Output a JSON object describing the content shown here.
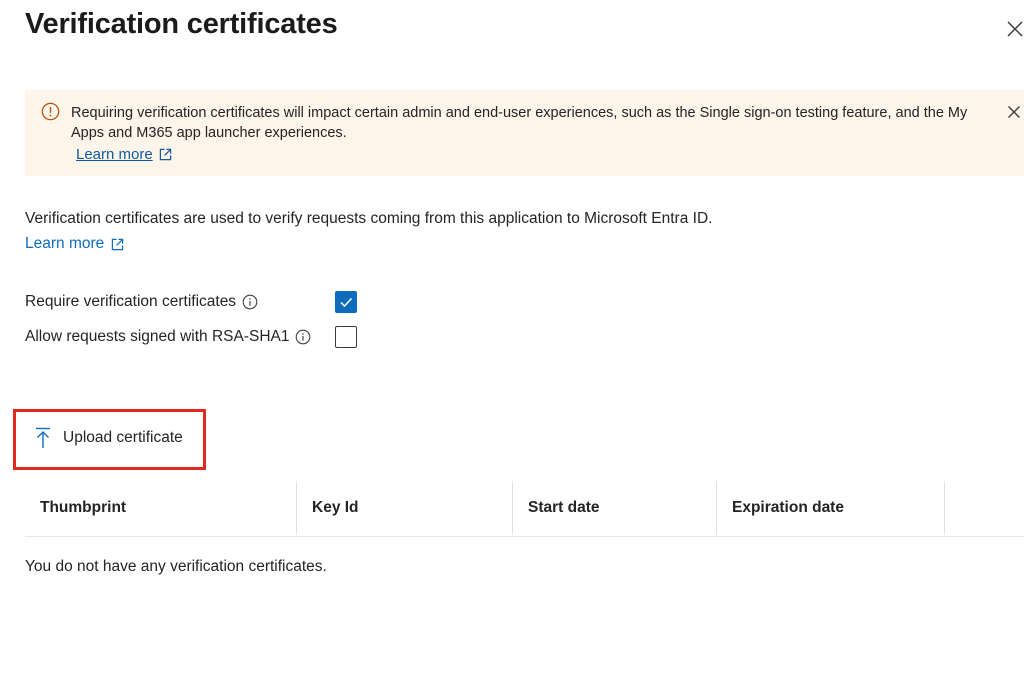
{
  "panel": {
    "title": "Verification certificates"
  },
  "warning": {
    "text": "Requiring verification certificates will impact certain admin and end-user experiences, such as the Single sign-on testing feature, and the My Apps and M365 app launcher experiences.",
    "link_label": "Learn more"
  },
  "description": {
    "text": "Verification certificates are used to verify requests coming from this application to Microsoft Entra ID.",
    "link_label": "Learn more"
  },
  "options": [
    {
      "label": "Require verification certificates",
      "checked": true
    },
    {
      "label": "Allow requests signed with RSA-SHA1",
      "checked": false
    }
  ],
  "toolbar": {
    "upload_label": "Upload certificate"
  },
  "table": {
    "columns": [
      "Thumbprint",
      "Key Id",
      "Start date",
      "Expiration date"
    ],
    "empty_message": "You do not have any verification certificates."
  },
  "colors": {
    "accent": "#0f6cbd",
    "warning_background": "#fdf5e9",
    "warning_icon": "#bc4b09",
    "highlight_border": "#e0291f"
  },
  "icons": {
    "close": "close-icon",
    "warning": "warning-icon",
    "external_link": "external-link-icon",
    "info": "info-icon",
    "upload": "upload-icon",
    "check": "checkmark-icon"
  }
}
